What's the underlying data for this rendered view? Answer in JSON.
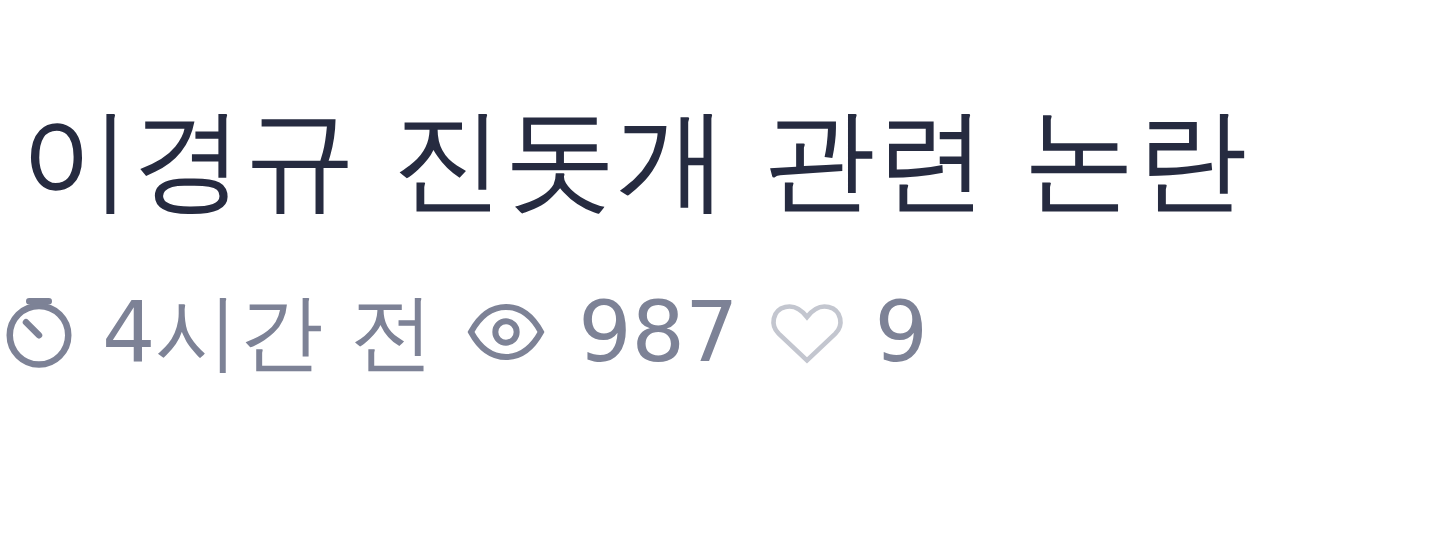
{
  "post": {
    "title": "이경규 진돗개 관련 논란",
    "meta": {
      "time": "4시간 전",
      "views": "987",
      "likes": "9",
      "liked": false
    }
  }
}
